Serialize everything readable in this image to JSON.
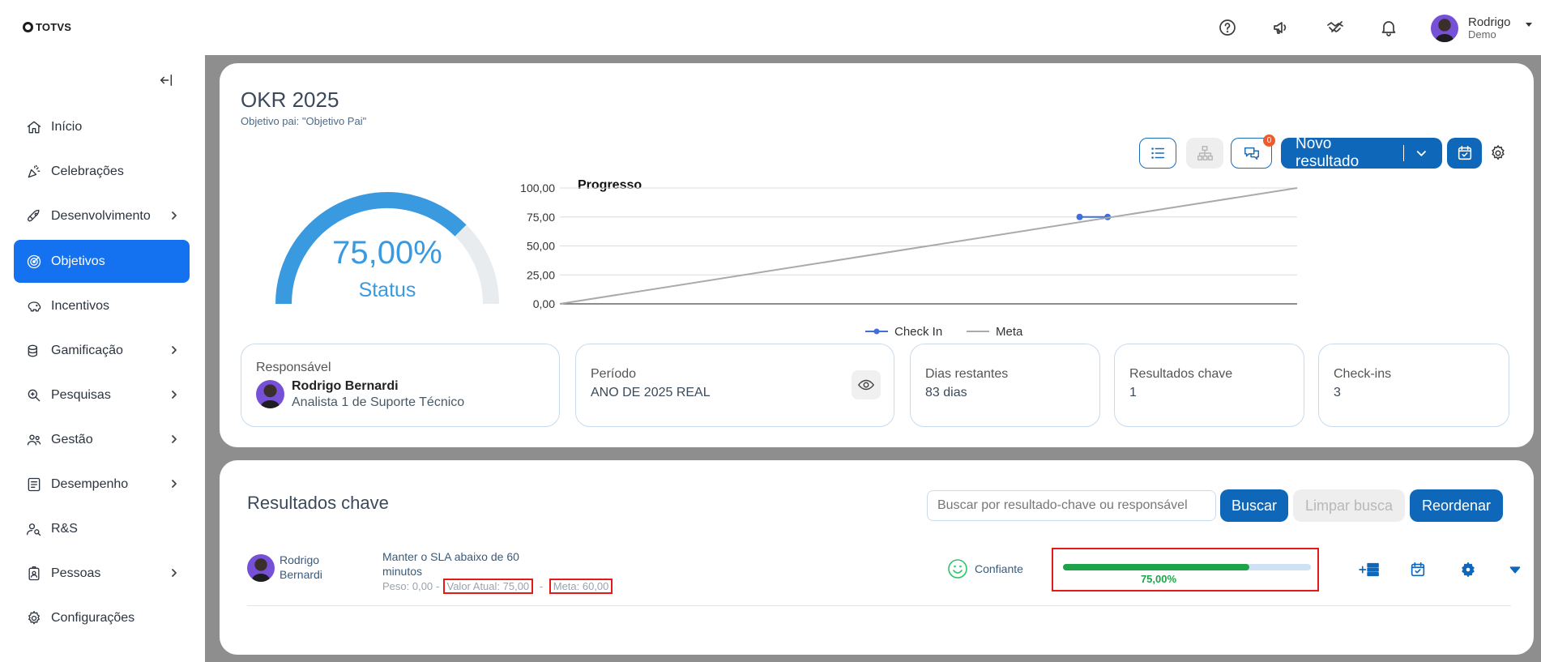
{
  "brand": {
    "name": "TOTVS"
  },
  "header": {
    "icons": [
      "help-icon",
      "megaphone-icon",
      "handshake-icon",
      "bell-icon"
    ],
    "user": {
      "name": "Rodrigo",
      "role": "Demo"
    }
  },
  "sidebar": {
    "items": [
      {
        "label": "Início",
        "icon": "home-icon",
        "has_children": false
      },
      {
        "label": "Celebrações",
        "icon": "party-icon",
        "has_children": false
      },
      {
        "label": "Desenvolvimento",
        "icon": "rocket-icon",
        "has_children": true
      },
      {
        "label": "Objetivos",
        "icon": "target-icon",
        "has_children": false,
        "active": true
      },
      {
        "label": "Incentivos",
        "icon": "piggy-bank-icon",
        "has_children": false
      },
      {
        "label": "Gamificação",
        "icon": "coins-icon",
        "has_children": true
      },
      {
        "label": "Pesquisas",
        "icon": "search-doc-icon",
        "has_children": true
      },
      {
        "label": "Gestão",
        "icon": "people-icon",
        "has_children": true
      },
      {
        "label": "Desempenho",
        "icon": "checklist-icon",
        "has_children": true
      },
      {
        "label": "R&S",
        "icon": "user-search-icon",
        "has_children": false
      },
      {
        "label": "Pessoas",
        "icon": "badge-icon",
        "has_children": true
      },
      {
        "label": "Configurações",
        "icon": "gear-icon",
        "has_children": false
      }
    ]
  },
  "okr": {
    "title": "OKR 2025",
    "parent": "Objetivo pai: \"Objetivo Pai\"",
    "toolbar": {
      "comments_badge": "0",
      "new_result_label": "Novo resultado"
    },
    "status": {
      "value": "75,00%",
      "label": "Status",
      "fraction": 0.75
    },
    "info": {
      "responsavel": {
        "label": "Responsável",
        "name": "Rodrigo Bernardi",
        "role": "Analista 1 de Suporte Técnico"
      },
      "periodo": {
        "label": "Período",
        "value": "ANO DE 2025 REAL"
      },
      "dias": {
        "label": "Dias restantes",
        "value": "83 dias"
      },
      "resultados": {
        "label": "Resultados chave",
        "value": "1"
      },
      "checkins": {
        "label": "Check-ins",
        "value": "3"
      }
    }
  },
  "chart_data": {
    "type": "line",
    "title": "Progresso",
    "xlabel": "",
    "ylabel": "",
    "ylim": [
      0,
      100
    ],
    "y_ticks": [
      "100,00",
      "75,00",
      "50,00",
      "25,00",
      "0,00"
    ],
    "x": [
      0,
      1
    ],
    "series": [
      {
        "name": "Check In",
        "color": "#3f6fd8",
        "points": [
          [
            0.705,
            75
          ],
          [
            0.743,
            75
          ]
        ]
      },
      {
        "name": "Meta",
        "color": "#aaaaaa",
        "points": [
          [
            0,
            0
          ],
          [
            1,
            100
          ]
        ]
      }
    ],
    "grid": true,
    "legend": "bottom"
  },
  "key_results": {
    "title": "Resultados chave",
    "search_placeholder": "Buscar por resultado-chave ou responsável",
    "buttons": {
      "search": "Buscar",
      "clear": "Limpar busca",
      "reorder": "Reordenar"
    },
    "rows": [
      {
        "owner": "Rodrigo Bernardi",
        "description": "Manter o SLA abaixo de 60 minutos",
        "weight": "Peso: 0,00",
        "current": "Valor Atual: 75,00",
        "target": "Meta: 60,00",
        "status": "Confiante",
        "progress_label": "75,00%",
        "progress": 0.75
      }
    ]
  }
}
